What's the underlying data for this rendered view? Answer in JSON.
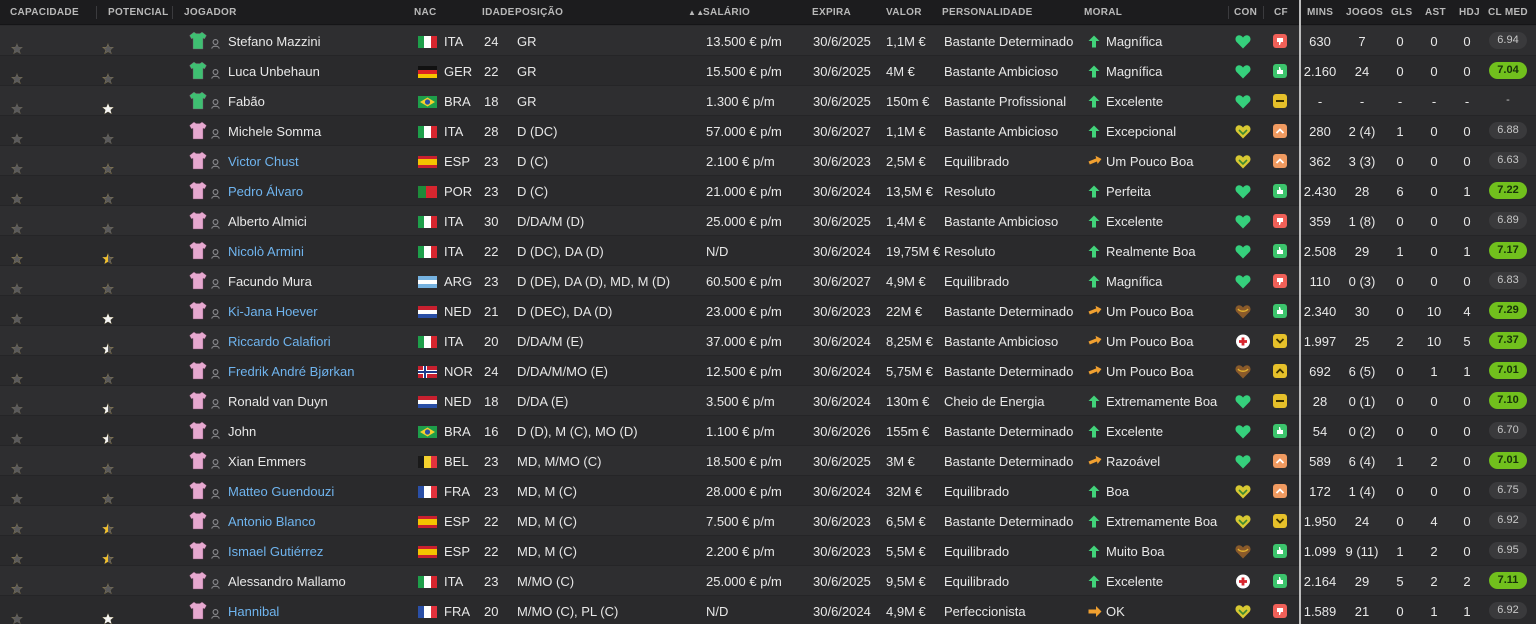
{
  "headers": {
    "capacidade": "CAPACIDADE",
    "potencial": "POTENCIAL",
    "jogador": "JOGADOR",
    "nac": "NAC",
    "idade": "IDADE",
    "posicao": "POSIÇÃO",
    "salario": "SALÁRIO",
    "expira": "EXPIRA",
    "valor": "VALOR",
    "personalidade": "PERSONALIDADE",
    "moral": "MORAL",
    "con": "CON",
    "cf": "CF",
    "mins": "MINS",
    "jogos": "JOGOS",
    "gls": "GLS",
    "ast": "AST",
    "hdj": "HDJ",
    "clmed": "CL MED"
  },
  "sort_indicator": "▲▲",
  "colors": {
    "star_gold": "#f2c12e",
    "star_white": "#f4f4f4",
    "star_empty": "#5a5a5c",
    "link": "#6fb4ee",
    "rating_green": "#71c01d",
    "moral_green": "#42d37a",
    "moral_orange": "#f0a030",
    "con_green": "#35d07c",
    "cf_red": "#f06058",
    "cf_green": "#3cc46c",
    "cf_yellow": "#e6c02a",
    "cf_orange": "#f09a60"
  },
  "players": [
    {
      "capacidade": [
        1,
        1,
        0.5,
        0,
        0
      ],
      "potencial": [
        1,
        1,
        1,
        0.5,
        0
      ],
      "pot_white": false,
      "kit": "gk",
      "nome": "Stefano Mazzini",
      "link": false,
      "nac": "ITA",
      "flag": "ita",
      "idade": "24",
      "posicao": "GR",
      "salario": "13.500 € p/m",
      "expira": "30/6/2025",
      "valor": "1,1M €",
      "personalidade": "Bastante Determinado",
      "moral": "Magnífica",
      "moral_icon": "up",
      "con": "green-heart",
      "cf": "red",
      "mins": "630",
      "jogos": "7",
      "gls": "0",
      "ast": "0",
      "hdj": "0",
      "rating": "6.94",
      "rating_style": "plain"
    },
    {
      "capacidade": [
        1,
        1,
        1,
        0,
        0
      ],
      "potencial": [
        1,
        1,
        1,
        0.5,
        0
      ],
      "pot_white": false,
      "kit": "gk",
      "nome": "Luca Unbehaun",
      "link": false,
      "nac": "GER",
      "flag": "ger",
      "idade": "22",
      "posicao": "GR",
      "salario": "15.500 € p/m",
      "expira": "30/6/2025",
      "valor": "4M €",
      "personalidade": "Bastante Ambicioso",
      "moral": "Magnífica",
      "moral_icon": "up",
      "con": "green-heart",
      "cf": "green",
      "mins": "2.160",
      "jogos": "24",
      "gls": "0",
      "ast": "0",
      "hdj": "0",
      "rating": "7.04",
      "rating_style": "good"
    },
    {
      "capacidade": [
        1,
        1,
        0,
        0,
        0
      ],
      "potencial": [
        1,
        1,
        1,
        1,
        1
      ],
      "pot_white": true,
      "kit": "gk",
      "nome": "Fabão",
      "link": false,
      "nac": "BRA",
      "flag": "bra",
      "idade": "18",
      "posicao": "GR",
      "salario": "1.300 € p/m",
      "expira": "30/6/2025",
      "valor": "150m €",
      "personalidade": "Bastante Profissional",
      "moral": "Excelente",
      "moral_icon": "up",
      "con": "green-heart",
      "cf": "yellow-minus",
      "mins": "-",
      "jogos": "-",
      "gls": "-",
      "ast": "-",
      "hdj": "-",
      "rating": "-",
      "rating_style": "none"
    },
    {
      "capacidade": [
        1,
        1,
        0,
        0,
        0
      ],
      "potencial": [
        1,
        1,
        0,
        0,
        0
      ],
      "pot_white": false,
      "kit": "out",
      "nome": "Michele Somma",
      "link": false,
      "nac": "ITA",
      "flag": "ita",
      "idade": "28",
      "posicao": "D (DC)",
      "salario": "57.000 € p/m",
      "expira": "30/6/2027",
      "valor": "1,1M €",
      "personalidade": "Bastante Ambicioso",
      "moral": "Excepcional",
      "moral_icon": "up",
      "con": "yellow-heart",
      "cf": "orange-up",
      "mins": "280",
      "jogos": "2 (4)",
      "gls": "1",
      "ast": "0",
      "hdj": "0",
      "rating": "6.88",
      "rating_style": "plain"
    },
    {
      "capacidade": [
        1,
        1,
        0.5,
        0,
        0
      ],
      "potencial": [
        1,
        1,
        1,
        1,
        0
      ],
      "pot_white": false,
      "kit": "out",
      "nome": "Victor Chust",
      "link": true,
      "nac": "ESP",
      "flag": "esp",
      "idade": "23",
      "posicao": "D (C)",
      "salario": "2.100 € p/m",
      "expira": "30/6/2023",
      "valor": "2,5M €",
      "personalidade": "Equilibrado",
      "moral": "Um Pouco Boa",
      "moral_icon": "side",
      "con": "yellow-heart",
      "cf": "orange-up",
      "mins": "362",
      "jogos": "3 (3)",
      "gls": "0",
      "ast": "0",
      "hdj": "0",
      "rating": "6.63",
      "rating_style": "plain"
    },
    {
      "capacidade": [
        1,
        1,
        1,
        0,
        0
      ],
      "potencial": [
        1,
        1,
        1,
        0.5,
        0
      ],
      "pot_white": false,
      "kit": "out",
      "nome": "Pedro Álvaro",
      "link": true,
      "nac": "POR",
      "flag": "por",
      "idade": "23",
      "posicao": "D (C)",
      "salario": "21.000 € p/m",
      "expira": "30/6/2024",
      "valor": "13,5M €",
      "personalidade": "Resoluto",
      "moral": "Perfeita",
      "moral_icon": "up",
      "con": "green-heart",
      "cf": "green",
      "mins": "2.430",
      "jogos": "28",
      "gls": "6",
      "ast": "0",
      "hdj": "1",
      "rating": "7.22",
      "rating_style": "good"
    },
    {
      "capacidade": [
        1,
        1,
        0.5,
        0,
        0
      ],
      "potencial": [
        1,
        1,
        0.5,
        0,
        0
      ],
      "pot_white": false,
      "kit": "out",
      "nome": "Alberto Almici",
      "link": false,
      "nac": "ITA",
      "flag": "ita",
      "idade": "30",
      "posicao": "D/DA/M (D)",
      "salario": "25.000 € p/m",
      "expira": "30/6/2025",
      "valor": "1,4M €",
      "personalidade": "Bastante Ambicioso",
      "moral": "Excelente",
      "moral_icon": "up",
      "con": "green-heart",
      "cf": "red",
      "mins": "359",
      "jogos": "1 (8)",
      "gls": "0",
      "ast": "0",
      "hdj": "0",
      "rating": "6.89",
      "rating_style": "plain"
    },
    {
      "capacidade": [
        1,
        1,
        1,
        1,
        0
      ],
      "potencial": [
        1,
        1,
        1,
        1,
        0.5
      ],
      "pot_white": false,
      "kit": "out",
      "nome": "Nicolò Armini",
      "link": true,
      "nac": "ITA",
      "flag": "ita",
      "idade": "22",
      "posicao": "D (DC), DA (D)",
      "salario": "N/D",
      "expira": "30/6/2024",
      "valor": "19,75M €",
      "personalidade": "Resoluto",
      "moral": "Realmente Boa",
      "moral_icon": "up",
      "con": "green-heart",
      "cf": "green",
      "mins": "2.508",
      "jogos": "29",
      "gls": "1",
      "ast": "0",
      "hdj": "1",
      "rating": "7.17",
      "rating_style": "good"
    },
    {
      "capacidade": [
        1,
        1,
        0.5,
        0,
        0
      ],
      "potencial": [
        1,
        1,
        1,
        0.5,
        0
      ],
      "pot_white": false,
      "kit": "out",
      "nome": "Facundo Mura",
      "link": false,
      "nac": "ARG",
      "flag": "arg",
      "idade": "23",
      "posicao": "D (DE), DA (D), MD, M (D)",
      "salario": "60.500 € p/m",
      "expira": "30/6/2027",
      "valor": "4,9M €",
      "personalidade": "Equilibrado",
      "moral": "Magnífica",
      "moral_icon": "up",
      "con": "green-heart",
      "cf": "red",
      "mins": "110",
      "jogos": "0 (3)",
      "gls": "0",
      "ast": "0",
      "hdj": "0",
      "rating": "6.83",
      "rating_style": "plain"
    },
    {
      "capacidade": [
        1,
        1,
        0.5,
        0,
        0
      ],
      "potencial": [
        1,
        1,
        1,
        1,
        1
      ],
      "pot_white": true,
      "kit": "out",
      "nome": "Ki-Jana Hoever",
      "link": true,
      "nac": "NED",
      "flag": "ned",
      "idade": "21",
      "posicao": "D (DEC), DA (D)",
      "salario": "23.000 € p/m",
      "expira": "30/6/2023",
      "valor": "22M €",
      "personalidade": "Bastante Determinado",
      "moral": "Um Pouco Boa",
      "moral_icon": "side",
      "con": "brown-heart",
      "cf": "green",
      "mins": "2.340",
      "jogos": "30",
      "gls": "0",
      "ast": "10",
      "hdj": "4",
      "rating": "7.29",
      "rating_style": "good"
    },
    {
      "capacidade": [
        1,
        1,
        1,
        0,
        0
      ],
      "potencial": [
        1,
        1,
        1,
        1,
        0.5
      ],
      "pot_white": true,
      "kit": "out",
      "nome": "Riccardo Calafiori",
      "link": true,
      "nac": "ITA",
      "flag": "ita",
      "idade": "20",
      "posicao": "D/DA/M (E)",
      "salario": "37.000 € p/m",
      "expira": "30/6/2024",
      "valor": "8,25M €",
      "personalidade": "Bastante Ambicioso",
      "moral": "Um Pouco Boa",
      "moral_icon": "side",
      "con": "red-cross",
      "cf": "yellow-down",
      "mins": "1.997",
      "jogos": "25",
      "gls": "2",
      "ast": "10",
      "hdj": "5",
      "rating": "7.37",
      "rating_style": "good"
    },
    {
      "capacidade": [
        1,
        1,
        1,
        0,
        0
      ],
      "potencial": [
        1,
        1,
        1,
        0.5,
        0
      ],
      "pot_white": false,
      "kit": "out",
      "nome": "Fredrik André Bjørkan",
      "link": true,
      "nac": "NOR",
      "flag": "nor",
      "idade": "24",
      "posicao": "D/DA/M/MO (E)",
      "salario": "12.500 € p/m",
      "expira": "30/6/2024",
      "valor": "5,75M €",
      "personalidade": "Bastante Determinado",
      "moral": "Um Pouco Boa",
      "moral_icon": "side",
      "con": "brown-heart",
      "cf": "yellow-up",
      "mins": "692",
      "jogos": "6 (5)",
      "gls": "0",
      "ast": "1",
      "hdj": "1",
      "rating": "7.01",
      "rating_style": "good"
    },
    {
      "capacidade": [
        1,
        1,
        0,
        0,
        0
      ],
      "potencial": [
        1,
        1,
        1,
        1,
        0.5
      ],
      "pot_white": true,
      "kit": "out",
      "nome": "Ronald van Duyn",
      "link": false,
      "nac": "NED",
      "flag": "ned",
      "idade": "18",
      "posicao": "D/DA (E)",
      "salario": "3.500 € p/m",
      "expira": "30/6/2024",
      "valor": "130m €",
      "personalidade": "Cheio de Energia",
      "moral": "Extremamente Boa",
      "moral_icon": "up",
      "con": "green-heart",
      "cf": "yellow-minus",
      "mins": "28",
      "jogos": "0 (1)",
      "gls": "0",
      "ast": "0",
      "hdj": "0",
      "rating": "7.10",
      "rating_style": "good"
    },
    {
      "capacidade": [
        1,
        1,
        0,
        0,
        0
      ],
      "potencial": [
        1,
        1,
        1,
        1,
        0.5
      ],
      "pot_white": true,
      "kit": "out",
      "nome": "John",
      "link": false,
      "nac": "BRA",
      "flag": "bra",
      "idade": "16",
      "posicao": "D (D), M (C), MO (D)",
      "salario": "1.100 € p/m",
      "expira": "30/6/2026",
      "valor": "155m €",
      "personalidade": "Bastante Determinado",
      "moral": "Excelente",
      "moral_icon": "up",
      "con": "green-heart",
      "cf": "green",
      "mins": "54",
      "jogos": "0 (2)",
      "gls": "0",
      "ast": "0",
      "hdj": "0",
      "rating": "6.70",
      "rating_style": "plain"
    },
    {
      "capacidade": [
        1,
        1,
        0.5,
        0,
        0
      ],
      "potencial": [
        1,
        1,
        1,
        0.5,
        0
      ],
      "pot_white": false,
      "kit": "out",
      "nome": "Xian Emmers",
      "link": false,
      "nac": "BEL",
      "flag": "bel",
      "idade": "23",
      "posicao": "MD, M/MO (C)",
      "salario": "18.500 € p/m",
      "expira": "30/6/2025",
      "valor": "3M €",
      "personalidade": "Bastante Determinado",
      "moral": "Razoável",
      "moral_icon": "side",
      "con": "green-heart",
      "cf": "orange-up",
      "mins": "589",
      "jogos": "6 (4)",
      "gls": "1",
      "ast": "2",
      "hdj": "0",
      "rating": "7.01",
      "rating_style": "good"
    },
    {
      "capacidade": [
        1,
        1,
        0.5,
        0,
        0
      ],
      "potencial": [
        1,
        1,
        1,
        0.5,
        0
      ],
      "pot_white": false,
      "kit": "out",
      "nome": "Matteo Guendouzi",
      "link": true,
      "nac": "FRA",
      "flag": "fra",
      "idade": "23",
      "posicao": "MD, M (C)",
      "salario": "28.000 € p/m",
      "expira": "30/6/2024",
      "valor": "32M €",
      "personalidade": "Equilibrado",
      "moral": "Boa",
      "moral_icon": "up",
      "con": "yellow-heart",
      "cf": "orange-up",
      "mins": "172",
      "jogos": "1 (4)",
      "gls": "0",
      "ast": "0",
      "hdj": "0",
      "rating": "6.75",
      "rating_style": "plain"
    },
    {
      "capacidade": [
        1,
        1,
        1,
        0.5,
        0
      ],
      "potencial": [
        1,
        1,
        1,
        1,
        0.5
      ],
      "pot_white": false,
      "kit": "out",
      "nome": "Antonio Blanco",
      "link": true,
      "nac": "ESP",
      "flag": "esp",
      "idade": "22",
      "posicao": "MD, M (C)",
      "salario": "7.500 € p/m",
      "expira": "30/6/2023",
      "valor": "6,5M €",
      "personalidade": "Bastante Determinado",
      "moral": "Extremamente Boa",
      "moral_icon": "up",
      "con": "yellow-heart",
      "cf": "yellow-down",
      "mins": "1.950",
      "jogos": "24",
      "gls": "0",
      "ast": "4",
      "hdj": "0",
      "rating": "6.92",
      "rating_style": "plain"
    },
    {
      "capacidade": [
        1,
        1,
        1,
        0.5,
        0
      ],
      "potencial": [
        1,
        1,
        1,
        1,
        0.5
      ],
      "pot_white": false,
      "kit": "out",
      "nome": "Ismael Gutiérrez",
      "link": true,
      "nac": "ESP",
      "flag": "esp",
      "idade": "22",
      "posicao": "MD, M (C)",
      "salario": "2.200 € p/m",
      "expira": "30/6/2023",
      "valor": "5,5M €",
      "personalidade": "Equilibrado",
      "moral": "Muito Boa",
      "moral_icon": "up",
      "con": "brown-heart",
      "cf": "green",
      "mins": "1.099",
      "jogos": "9 (11)",
      "gls": "1",
      "ast": "2",
      "hdj": "0",
      "rating": "6.95",
      "rating_style": "plain"
    },
    {
      "capacidade": [
        1,
        1,
        1,
        0.5,
        0
      ],
      "potencial": [
        1,
        1,
        1,
        0.5,
        0
      ],
      "pot_white": false,
      "kit": "out",
      "nome": "Alessandro Mallamo",
      "link": false,
      "nac": "ITA",
      "flag": "ita",
      "idade": "23",
      "posicao": "M/MO (C)",
      "salario": "25.000 € p/m",
      "expira": "30/6/2025",
      "valor": "9,5M €",
      "personalidade": "Equilibrado",
      "moral": "Excelente",
      "moral_icon": "up",
      "con": "red-cross",
      "cf": "green",
      "mins": "2.164",
      "jogos": "29",
      "gls": "5",
      "ast": "2",
      "hdj": "2",
      "rating": "7.11",
      "rating_style": "good"
    },
    {
      "capacidade": [
        1,
        1,
        0.5,
        0,
        0
      ],
      "potencial": [
        1,
        1,
        1,
        1,
        1
      ],
      "pot_white": true,
      "kit": "out",
      "nome": "Hannibal",
      "link": true,
      "nac": "FRA",
      "flag": "fra",
      "idade": "20",
      "posicao": "M/MO (C), PL (C)",
      "salario": "N/D",
      "expira": "30/6/2024",
      "valor": "4,9M €",
      "personalidade": "Perfeccionista",
      "moral": "OK",
      "moral_icon": "right",
      "con": "yellow-heart",
      "cf": "red",
      "mins": "1.589",
      "jogos": "21",
      "gls": "0",
      "ast": "1",
      "hdj": "1",
      "rating": "6.92",
      "rating_style": "plain"
    }
  ]
}
